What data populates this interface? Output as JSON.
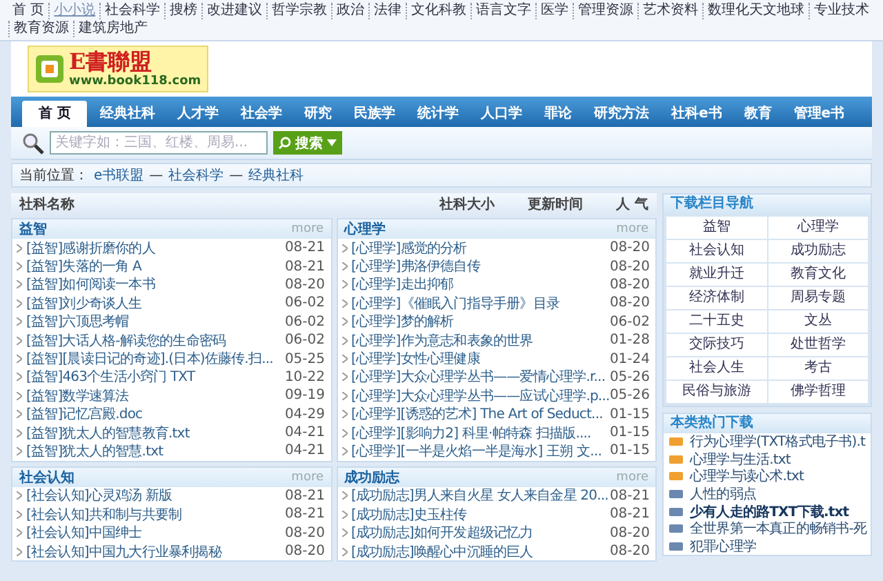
{
  "top_links": [
    {
      "label": "首 页",
      "selected": false
    },
    {
      "label": "小小说",
      "selected": true
    },
    {
      "label": "社会科学",
      "selected": false
    },
    {
      "label": "搜榜",
      "selected": false
    },
    {
      "label": "改进建议",
      "selected": false
    },
    {
      "label": "哲学宗教",
      "selected": false
    },
    {
      "label": "政治",
      "selected": false
    },
    {
      "label": "法律",
      "selected": false
    },
    {
      "label": "文化科教",
      "selected": false
    },
    {
      "label": "语言文字",
      "selected": false
    },
    {
      "label": "医学",
      "selected": false
    },
    {
      "label": "管理资源",
      "selected": false
    },
    {
      "label": "艺术资料",
      "selected": false
    },
    {
      "label": "数理化天文地球",
      "selected": false
    },
    {
      "label": "专业技术",
      "selected": false
    },
    {
      "label": "教育资源",
      "selected": false
    },
    {
      "label": "建筑房地产",
      "selected": false
    }
  ],
  "logo": {
    "name": "E書聯盟",
    "url": "www.book118.com"
  },
  "nav": [
    {
      "label": "首 页",
      "selected": true
    },
    {
      "label": "经典社科",
      "selected": false
    },
    {
      "label": "人才学",
      "selected": false
    },
    {
      "label": "社会学",
      "selected": false
    },
    {
      "label": "研究",
      "selected": false
    },
    {
      "label": "民族学",
      "selected": false
    },
    {
      "label": "统计学",
      "selected": false
    },
    {
      "label": "人口学",
      "selected": false
    },
    {
      "label": "罪论",
      "selected": false
    },
    {
      "label": "研究方法",
      "selected": false
    },
    {
      "label": "社科e书",
      "selected": false
    },
    {
      "label": "教育",
      "selected": false
    },
    {
      "label": "管理e书",
      "selected": false
    }
  ],
  "search": {
    "placeholder": "关键字如：三国、红楼、周易...",
    "button": "搜索"
  },
  "breadcrumb": {
    "prefix": "当前位置：",
    "items": [
      "e书联盟",
      "社会科学",
      "经典社科"
    ],
    "separator": "—"
  },
  "list_header": {
    "name": "社科名称",
    "size": "社科大小",
    "time": "更新时间",
    "popularity": "人 气"
  },
  "panels": [
    {
      "title": "益智",
      "more": "more",
      "rows": [
        {
          "title": "[益智]感谢折磨你的人",
          "date": "08-21"
        },
        {
          "title": "[益智]失落的一角 A",
          "date": "08-21"
        },
        {
          "title": "[益智]如何阅读一本书",
          "date": "08-20"
        },
        {
          "title": "[益智]刘少奇谈人生",
          "date": "06-02"
        },
        {
          "title": "[益智]六顶思考帽",
          "date": "06-02"
        },
        {
          "title": "[益智]大话人格-解读您的生命密码",
          "date": "06-02"
        },
        {
          "title": "[益智][晨读日记的奇迹].(日本)佐藤传.扫...",
          "date": "05-25"
        },
        {
          "title": "[益智]463个生活小窍门 TXT",
          "date": "10-22"
        },
        {
          "title": "[益智]数学速算法",
          "date": "09-19"
        },
        {
          "title": "[益智]记忆宫殿.doc",
          "date": "04-29"
        },
        {
          "title": "[益智]犹太人的智慧教育.txt",
          "date": "04-21"
        },
        {
          "title": "[益智]犹太人的智慧.txt",
          "date": "04-21"
        }
      ]
    },
    {
      "title": "心理学",
      "more": "more",
      "rows": [
        {
          "title": "[心理学]感觉的分析",
          "date": "08-20"
        },
        {
          "title": "[心理学]弗洛伊德自传",
          "date": "08-20"
        },
        {
          "title": "[心理学]走出抑郁",
          "date": "08-20"
        },
        {
          "title": "[心理学]《催眠入门指导手册》目录",
          "date": "08-20"
        },
        {
          "title": "[心理学]梦的解析",
          "date": "06-02"
        },
        {
          "title": "[心理学]作为意志和表象的世界",
          "date": "01-28"
        },
        {
          "title": "[心理学]女性心理健康",
          "date": "01-24"
        },
        {
          "title": "[心理学]大众心理学丛书——爱情心理学.r...",
          "date": "05-26"
        },
        {
          "title": "[心理学]大众心理学丛书——应试心理学.p...",
          "date": "05-26"
        },
        {
          "title": "[心理学][诱惑的艺术] The Art of Seduct...",
          "date": "01-15"
        },
        {
          "title": "[心理学][影响力2] 科里·帕特森 扫描版....",
          "date": "01-15"
        },
        {
          "title": "[心理学][一半是火焰一半是海水] 王朔 文...",
          "date": "01-15"
        }
      ]
    },
    {
      "title": "社会认知",
      "more": "more",
      "rows": [
        {
          "title": "[社会认知]心灵鸡汤 新版",
          "date": "08-21"
        },
        {
          "title": "[社会认知]共和制与共要制",
          "date": "08-21"
        },
        {
          "title": "[社会认知]中国绅士",
          "date": "08-20"
        },
        {
          "title": "[社会认知]中国九大行业暴利揭秘",
          "date": "08-20"
        }
      ]
    },
    {
      "title": "成功励志",
      "more": "more",
      "rows": [
        {
          "title": "[成功励志]男人来自火星 女人来自金星 20...",
          "date": "08-21"
        },
        {
          "title": "[成功励志]史玉柱传",
          "date": "08-21"
        },
        {
          "title": "[成功励志]如何开发超级记忆力",
          "date": "08-20"
        },
        {
          "title": "[成功励志]唤醒心中沉睡的巨人",
          "date": "08-20"
        }
      ]
    }
  ],
  "category_nav": {
    "title": "下载栏目导航",
    "items": [
      "益智",
      "心理学",
      "社会认知",
      "成功励志",
      "就业升迁",
      "教育文化",
      "经济体制",
      "周易专题",
      "二十五史",
      "文丛",
      "交际技巧",
      "处世哲学",
      "社会人生",
      "考古",
      "民俗与旅游",
      "佛学哲理"
    ]
  },
  "hot_downloads": {
    "title": "本类热门下载",
    "items": [
      {
        "title": "行为心理学(TXT格式电子书).t",
        "kind": "top",
        "bold": false
      },
      {
        "title": "心理学与生活.txt",
        "kind": "top",
        "bold": false
      },
      {
        "title": "心理学与读心术.txt",
        "kind": "top",
        "bold": false
      },
      {
        "title": "人性的弱点",
        "kind": "normal",
        "bold": false
      },
      {
        "title": "少有人走的路TXT下载.txt",
        "kind": "normal",
        "bold": true
      },
      {
        "title": "全世界第一本真正的畅销书-死",
        "kind": "normal",
        "bold": false
      },
      {
        "title": "犯罪心理学",
        "kind": "normal",
        "bold": false
      }
    ]
  }
}
